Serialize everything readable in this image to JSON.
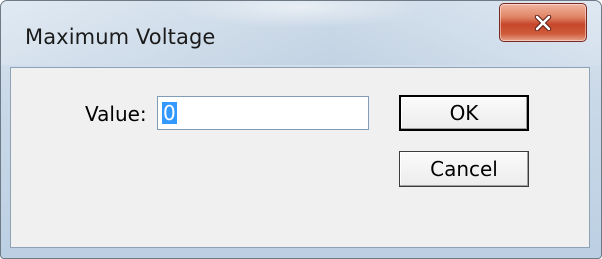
{
  "window": {
    "title": "Maximum Voltage",
    "close_icon": "close-icon"
  },
  "form": {
    "value_label": "Value:",
    "value_input": "0"
  },
  "buttons": {
    "ok_label": "OK",
    "cancel_label": "Cancel"
  },
  "colors": {
    "close_button": "#c7472c",
    "selection": "#3399ff"
  }
}
